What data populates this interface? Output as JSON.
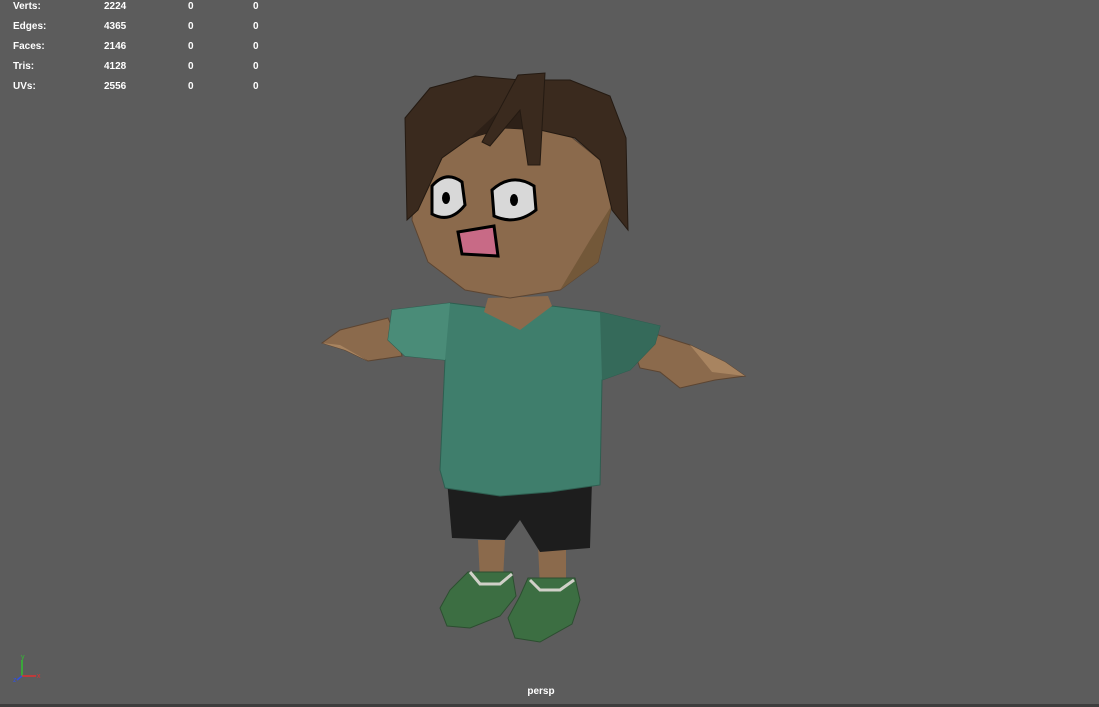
{
  "viewport": {
    "camera": "persp",
    "background_color": "#5c5c5c"
  },
  "stats": [
    {
      "label": "Verts:",
      "value": "2224",
      "col1": "0",
      "col2": "0"
    },
    {
      "label": "Edges:",
      "value": "4365",
      "col1": "0",
      "col2": "0"
    },
    {
      "label": "Faces:",
      "value": "2146",
      "col1": "0",
      "col2": "0"
    },
    {
      "label": "Tris:",
      "value": "4128",
      "col1": "0",
      "col2": "0"
    },
    {
      "label": "UVs:",
      "value": "2556",
      "col1": "0",
      "col2": "0"
    }
  ],
  "axis_gizmo": {
    "x_label": "x",
    "y_label": "y",
    "z_label": "z",
    "x_color": "#e03030",
    "y_color": "#30c030",
    "z_color": "#3050e0"
  },
  "model": {
    "skin_color": "#8b6a4c",
    "hair_color": "#3a2a1e",
    "shirt_color": "#3f7e6c",
    "shorts_color": "#1d1d1d",
    "shoes_color": "#3c6e42",
    "mouth_color": "#c86a86"
  }
}
